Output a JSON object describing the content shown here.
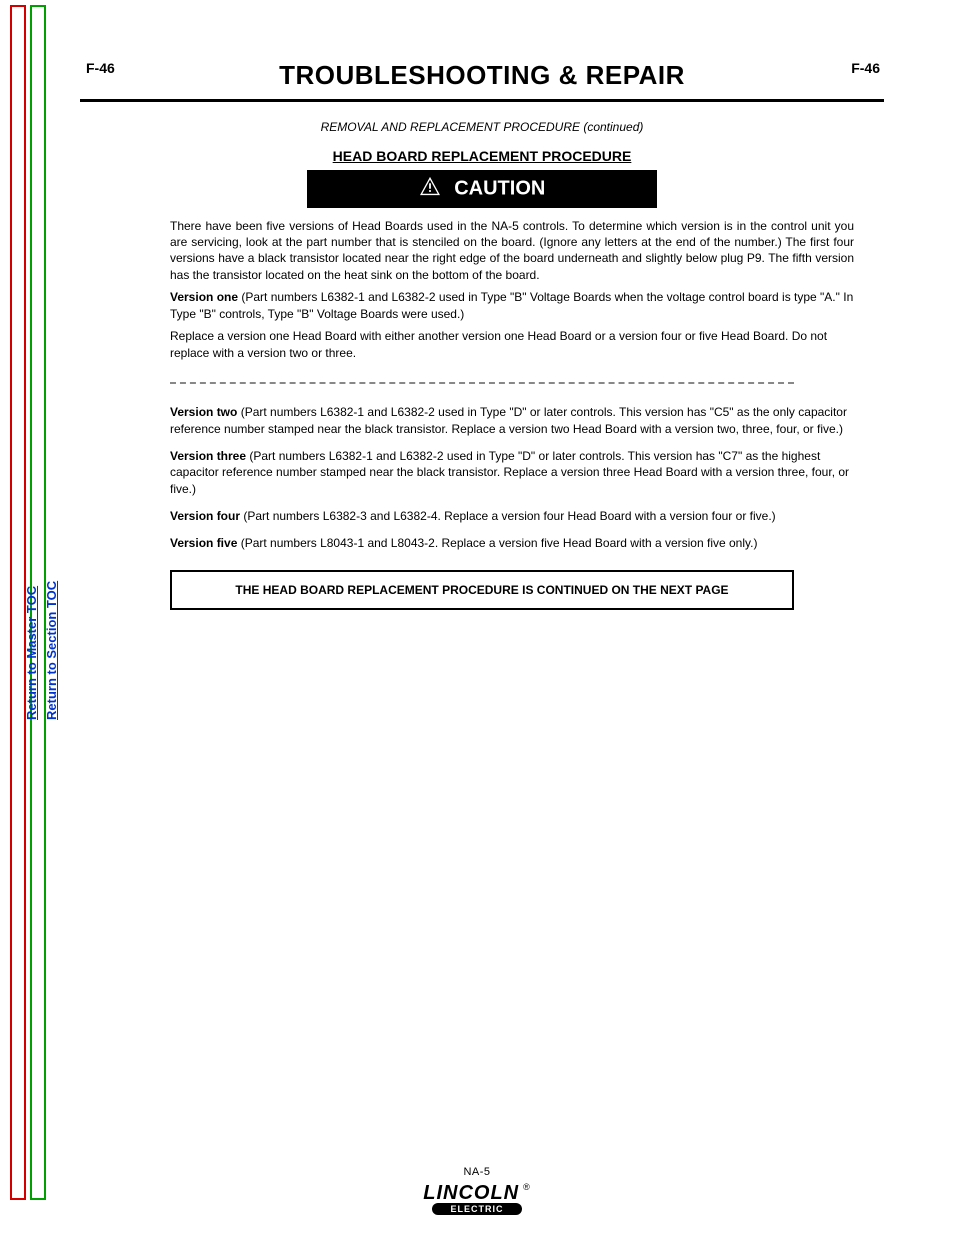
{
  "page_numbers": {
    "left": "F-46",
    "right": "F-46"
  },
  "header": {
    "title_left": "TROUBLESHOOTING & REPAIR",
    "title_right": "",
    "subtitle": "REMOVAL AND REPLACEMENT PROCEDURE (continued)",
    "section_heading": "HEAD BOARD REPLACEMENT PROCEDURE"
  },
  "caution_label": "CAUTION",
  "paragraphs": {
    "intro": "There have been five versions of Head Boards used in the NA-5 controls. To determine which version is in the control unit you are servicing, look at the part number that is stenciled on the board. (Ignore any letters at the end of the number.) The first four versions have a black transistor located near the right edge of the board underneath and slightly below plug P9. The fifth version has the transistor located on the heat sink on the bottom of the board.",
    "v1": "(Part numbers L6382-1 and L6382-2 used in Type \"B\" Voltage Boards when the voltage control board is type \"A.\" In Type \"B\" controls, Type \"B\" Voltage Boards were used.)",
    "v1_replace": "Replace a version one Head Board with either another version one Head Board or a version four or five Head Board. Do not replace with a version two or three.",
    "v2": "(Part numbers L6382-1 and L6382-2 used in Type \"D\" or later controls. This version has \"C5\" as the only capacitor reference number stamped near the black transistor. Replace a version two Head Board with a version two, three, four, or five.)",
    "v3": "(Part numbers L6382-1 and L6382-2 used in Type \"D\" or later controls. This version has \"C7\" as the highest capacitor reference number stamped near the black transistor. Replace a version three Head Board with a version three, four, or five.)",
    "v4": "(Part numbers L6382-3 and L6382-4. Replace a version four Head Board with a version four or five.)",
    "v5": "(Part numbers L8043-1 and L8043-2. Replace a version five Head Board with a version five only.)"
  },
  "labels": {
    "v1": "Version one",
    "v2": "Version two",
    "v3": "Version three",
    "v4": "Version four",
    "v5": "Version five"
  },
  "service_box": "THE HEAD BOARD REPLACEMENT PROCEDURE IS CONTINUED ON THE NEXT PAGE",
  "footer_model": "NA-5",
  "logo": {
    "brand": "LINCOLN",
    "plate": "ELECTRIC",
    "reg": "®"
  },
  "nav": {
    "return_main": "Return to Master TOC",
    "return_section": "Return to Section TOC"
  }
}
